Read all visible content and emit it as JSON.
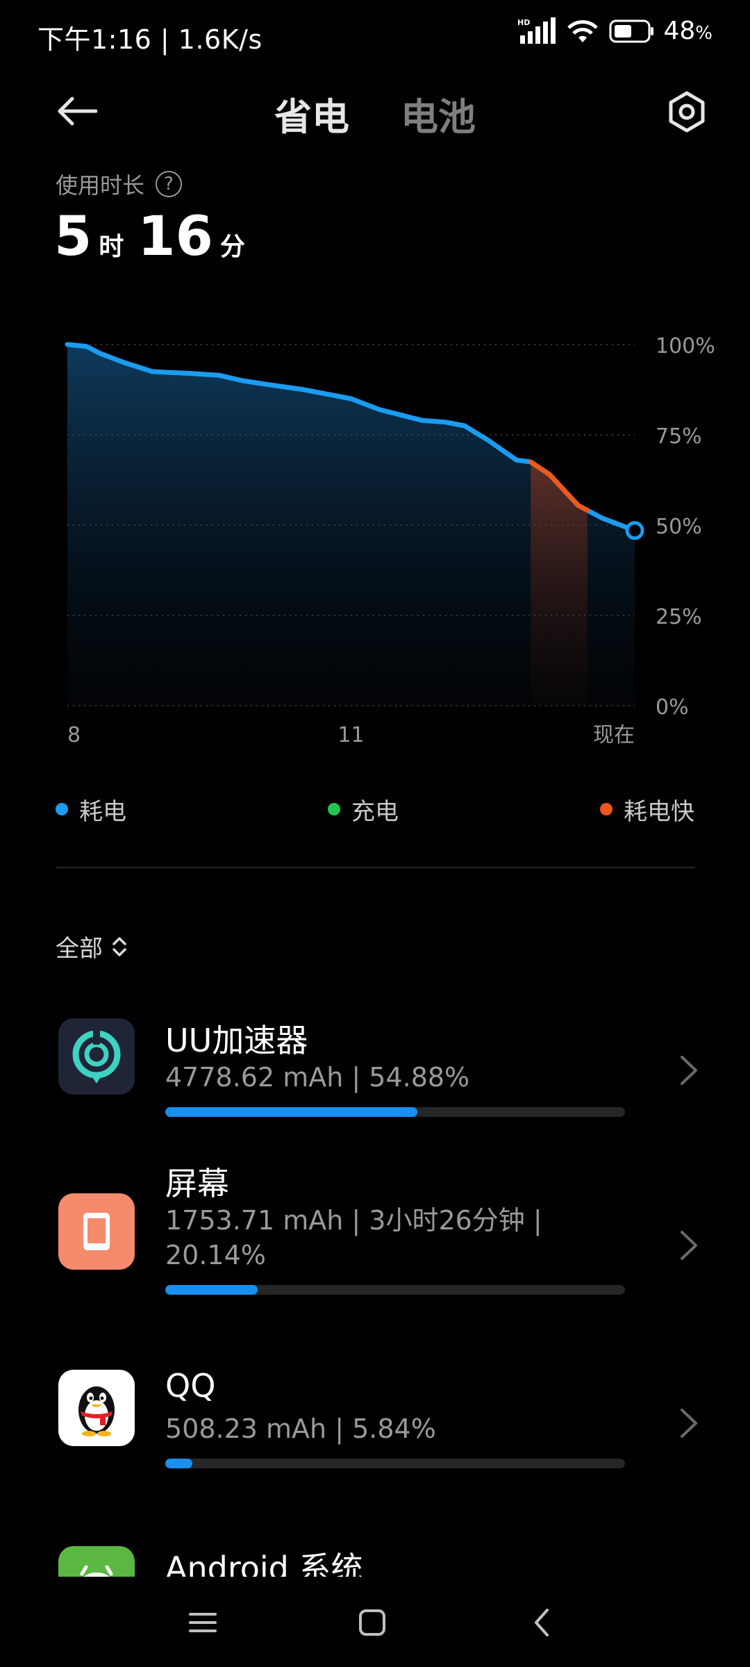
{
  "status_bar": {
    "time_speed": "下午1:16 | 1.6K/s",
    "hd_label": "HD",
    "battery_percent": "48",
    "battery_unit": "%"
  },
  "header": {
    "tabs": [
      {
        "label": "省电",
        "active": true
      },
      {
        "label": "电池",
        "active": false
      }
    ],
    "back_icon": "back-arrow-icon",
    "settings_icon": "hexagon-settings-icon"
  },
  "usage": {
    "label": "使用时长",
    "help": "?",
    "hours": "5",
    "hours_unit": "时",
    "minutes": "16",
    "minutes_unit": "分"
  },
  "chart_data": {
    "type": "area",
    "y_tick_labels": [
      "100%",
      "75%",
      "50%",
      "25%",
      "0%"
    ],
    "x_tick_labels": [
      "8",
      "11",
      "现在"
    ],
    "ylim": [
      0,
      100
    ],
    "xlim": [
      8,
      14
    ],
    "x": [
      8.0,
      8.2,
      8.35,
      8.6,
      8.9,
      9.3,
      9.6,
      9.85,
      10.1,
      10.5,
      10.7,
      11.0,
      11.3,
      11.75,
      12.0,
      12.2,
      12.45,
      12.75,
      12.9,
      13.1,
      13.4,
      13.65,
      13.85,
      14.0
    ],
    "values": [
      100,
      99.5,
      97.5,
      95,
      92.5,
      92,
      91.5,
      90,
      89,
      87.5,
      86.5,
      85,
      82,
      79,
      78.5,
      77.5,
      73.5,
      68,
      67.5,
      64,
      55.5,
      52,
      50,
      48.5
    ],
    "series_normal_color": "#1a9cf0",
    "series_fast_color": "#ec5a1e",
    "fast_ranges": [
      [
        12.9,
        13.5
      ]
    ]
  },
  "legend": [
    {
      "label": "耗电",
      "color": "#1a9cf0"
    },
    {
      "label": "充电",
      "color": "#23c552"
    },
    {
      "label": "耗电快",
      "color": "#f0561e"
    }
  ],
  "filter": {
    "label": "全部"
  },
  "apps": [
    {
      "name": "UU加速器",
      "info": "4778.62 mAh | 54.88%",
      "progress": 0.5488,
      "icon": "uu-accelerator-icon"
    },
    {
      "name": "屏幕",
      "info": "1753.71 mAh | 3小时26分钟 | 20.14%",
      "progress": 0.2014,
      "icon": "screen-icon"
    },
    {
      "name": "QQ",
      "info": "508.23 mAh | 5.84%",
      "progress": 0.0584,
      "icon": "qq-penguin-icon"
    },
    {
      "name": "Android 系统",
      "info": "",
      "progress": 0,
      "icon": "android-icon"
    }
  ],
  "nav": {
    "menu_icon": "menu-icon",
    "home_icon": "home-icon",
    "back_icon": "back-chevron-icon"
  }
}
